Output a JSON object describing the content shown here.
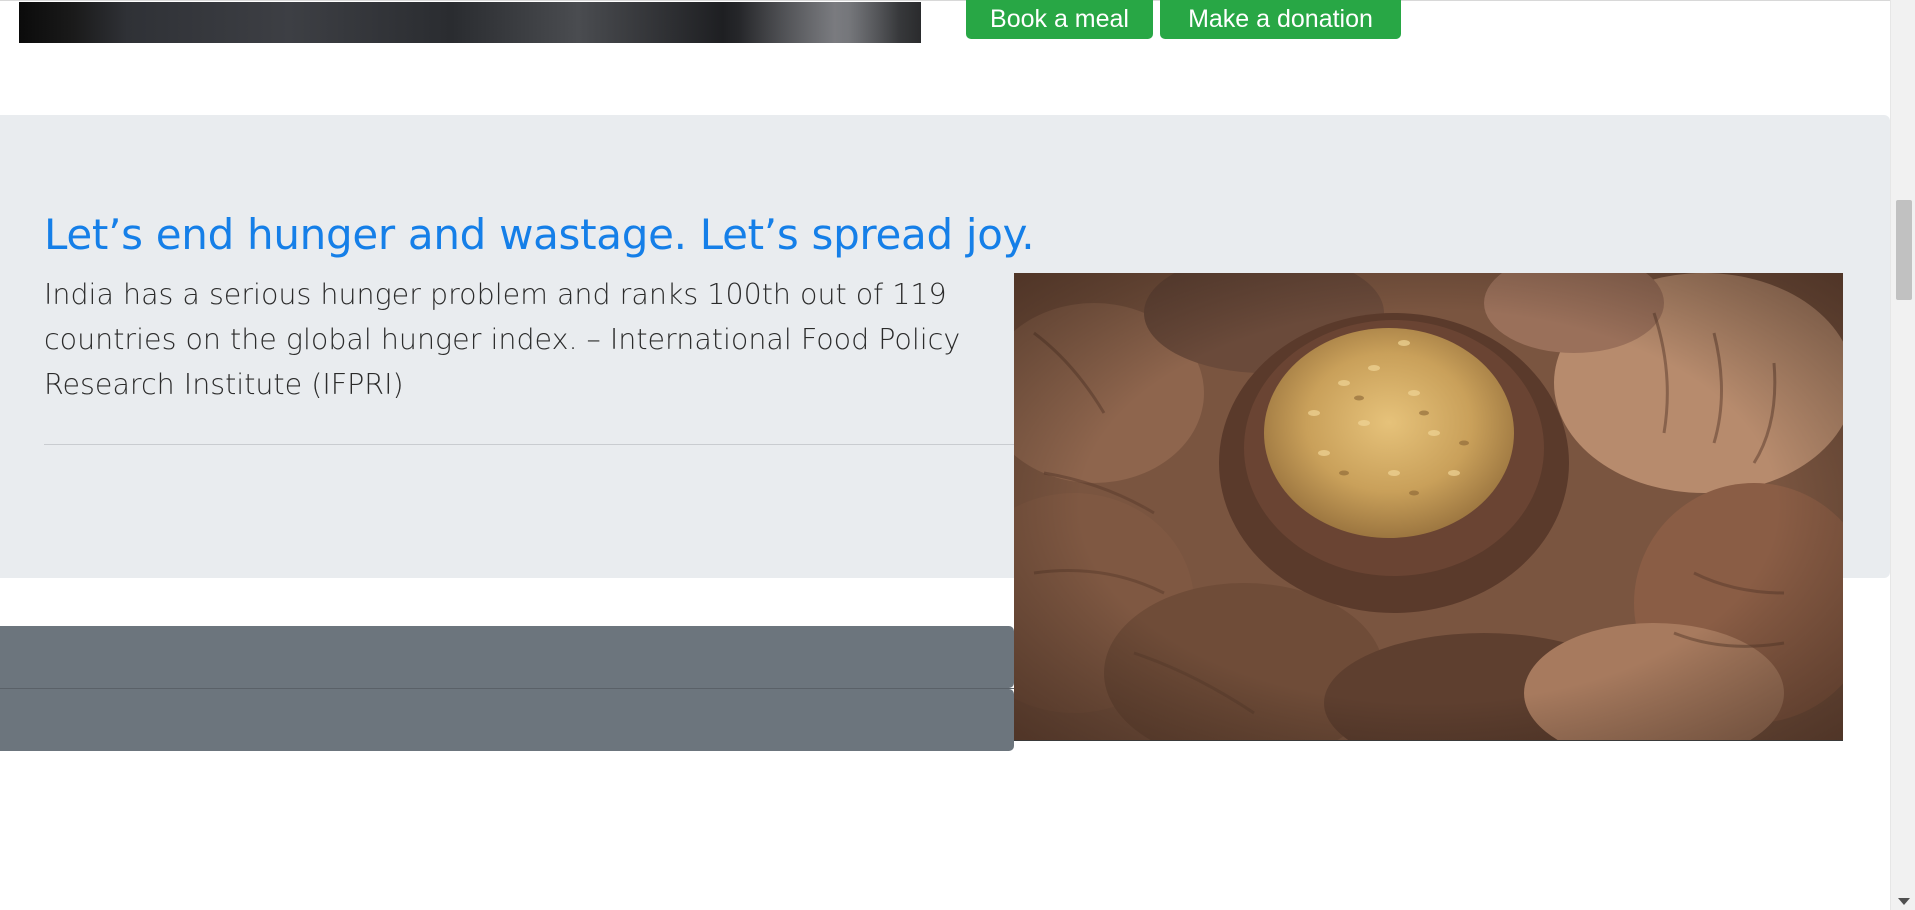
{
  "buttons": {
    "book_meal": "Book a meal",
    "donate": "Make a donation"
  },
  "hero": {
    "title": "Let’s end hunger and wastage. Let’s spread joy.",
    "text": "India has a serious hunger problem and ranks 100th out of 119 countries on the global hunger index. – International Food Policy Research Institute (IFPRI)"
  },
  "colors": {
    "accent_button": "#28a745",
    "title_blue": "#157fe8",
    "hero_background": "#e9ecef",
    "gray_bar": "#6c757d"
  },
  "icons": {
    "scroll_down": "chevron-down-icon"
  }
}
